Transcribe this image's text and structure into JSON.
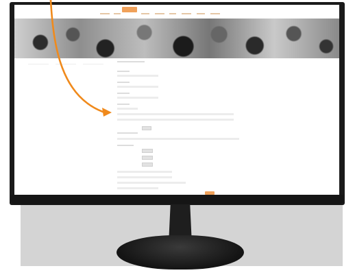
{
  "scene": {
    "description_items": [],
    "accent_color": "#f0a15a",
    "arrow_color": "#f08a1c"
  },
  "icons": {
    "arrow": "curved-arrow-icon"
  }
}
